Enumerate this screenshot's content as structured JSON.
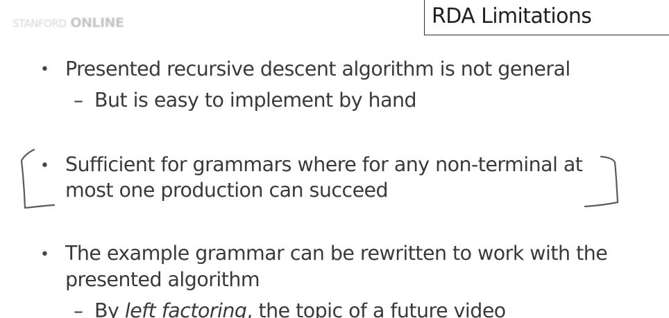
{
  "watermark": {
    "text": "STANFORD",
    "bold_text": "ONLINE"
  },
  "slide": {
    "title": "RDA Limitations",
    "bullets": [
      {
        "text": "Presented recursive descent algorithm is not general",
        "sub": "But is easy to implement by hand"
      },
      {
        "line1": "Sufficient for grammars where for any non-terminal at",
        "line2": "most one production can succeed"
      },
      {
        "line1": "The example grammar can be rewritten to work with the",
        "line2": "presented algorithm",
        "sub_prefix": "By ",
        "sub_em": "left factoring",
        "sub_suffix": ", the topic of a future video"
      }
    ]
  },
  "colors": {
    "text": "#3a3a3a",
    "title": "#1f1f1f",
    "ink": "#5a5a5a"
  }
}
